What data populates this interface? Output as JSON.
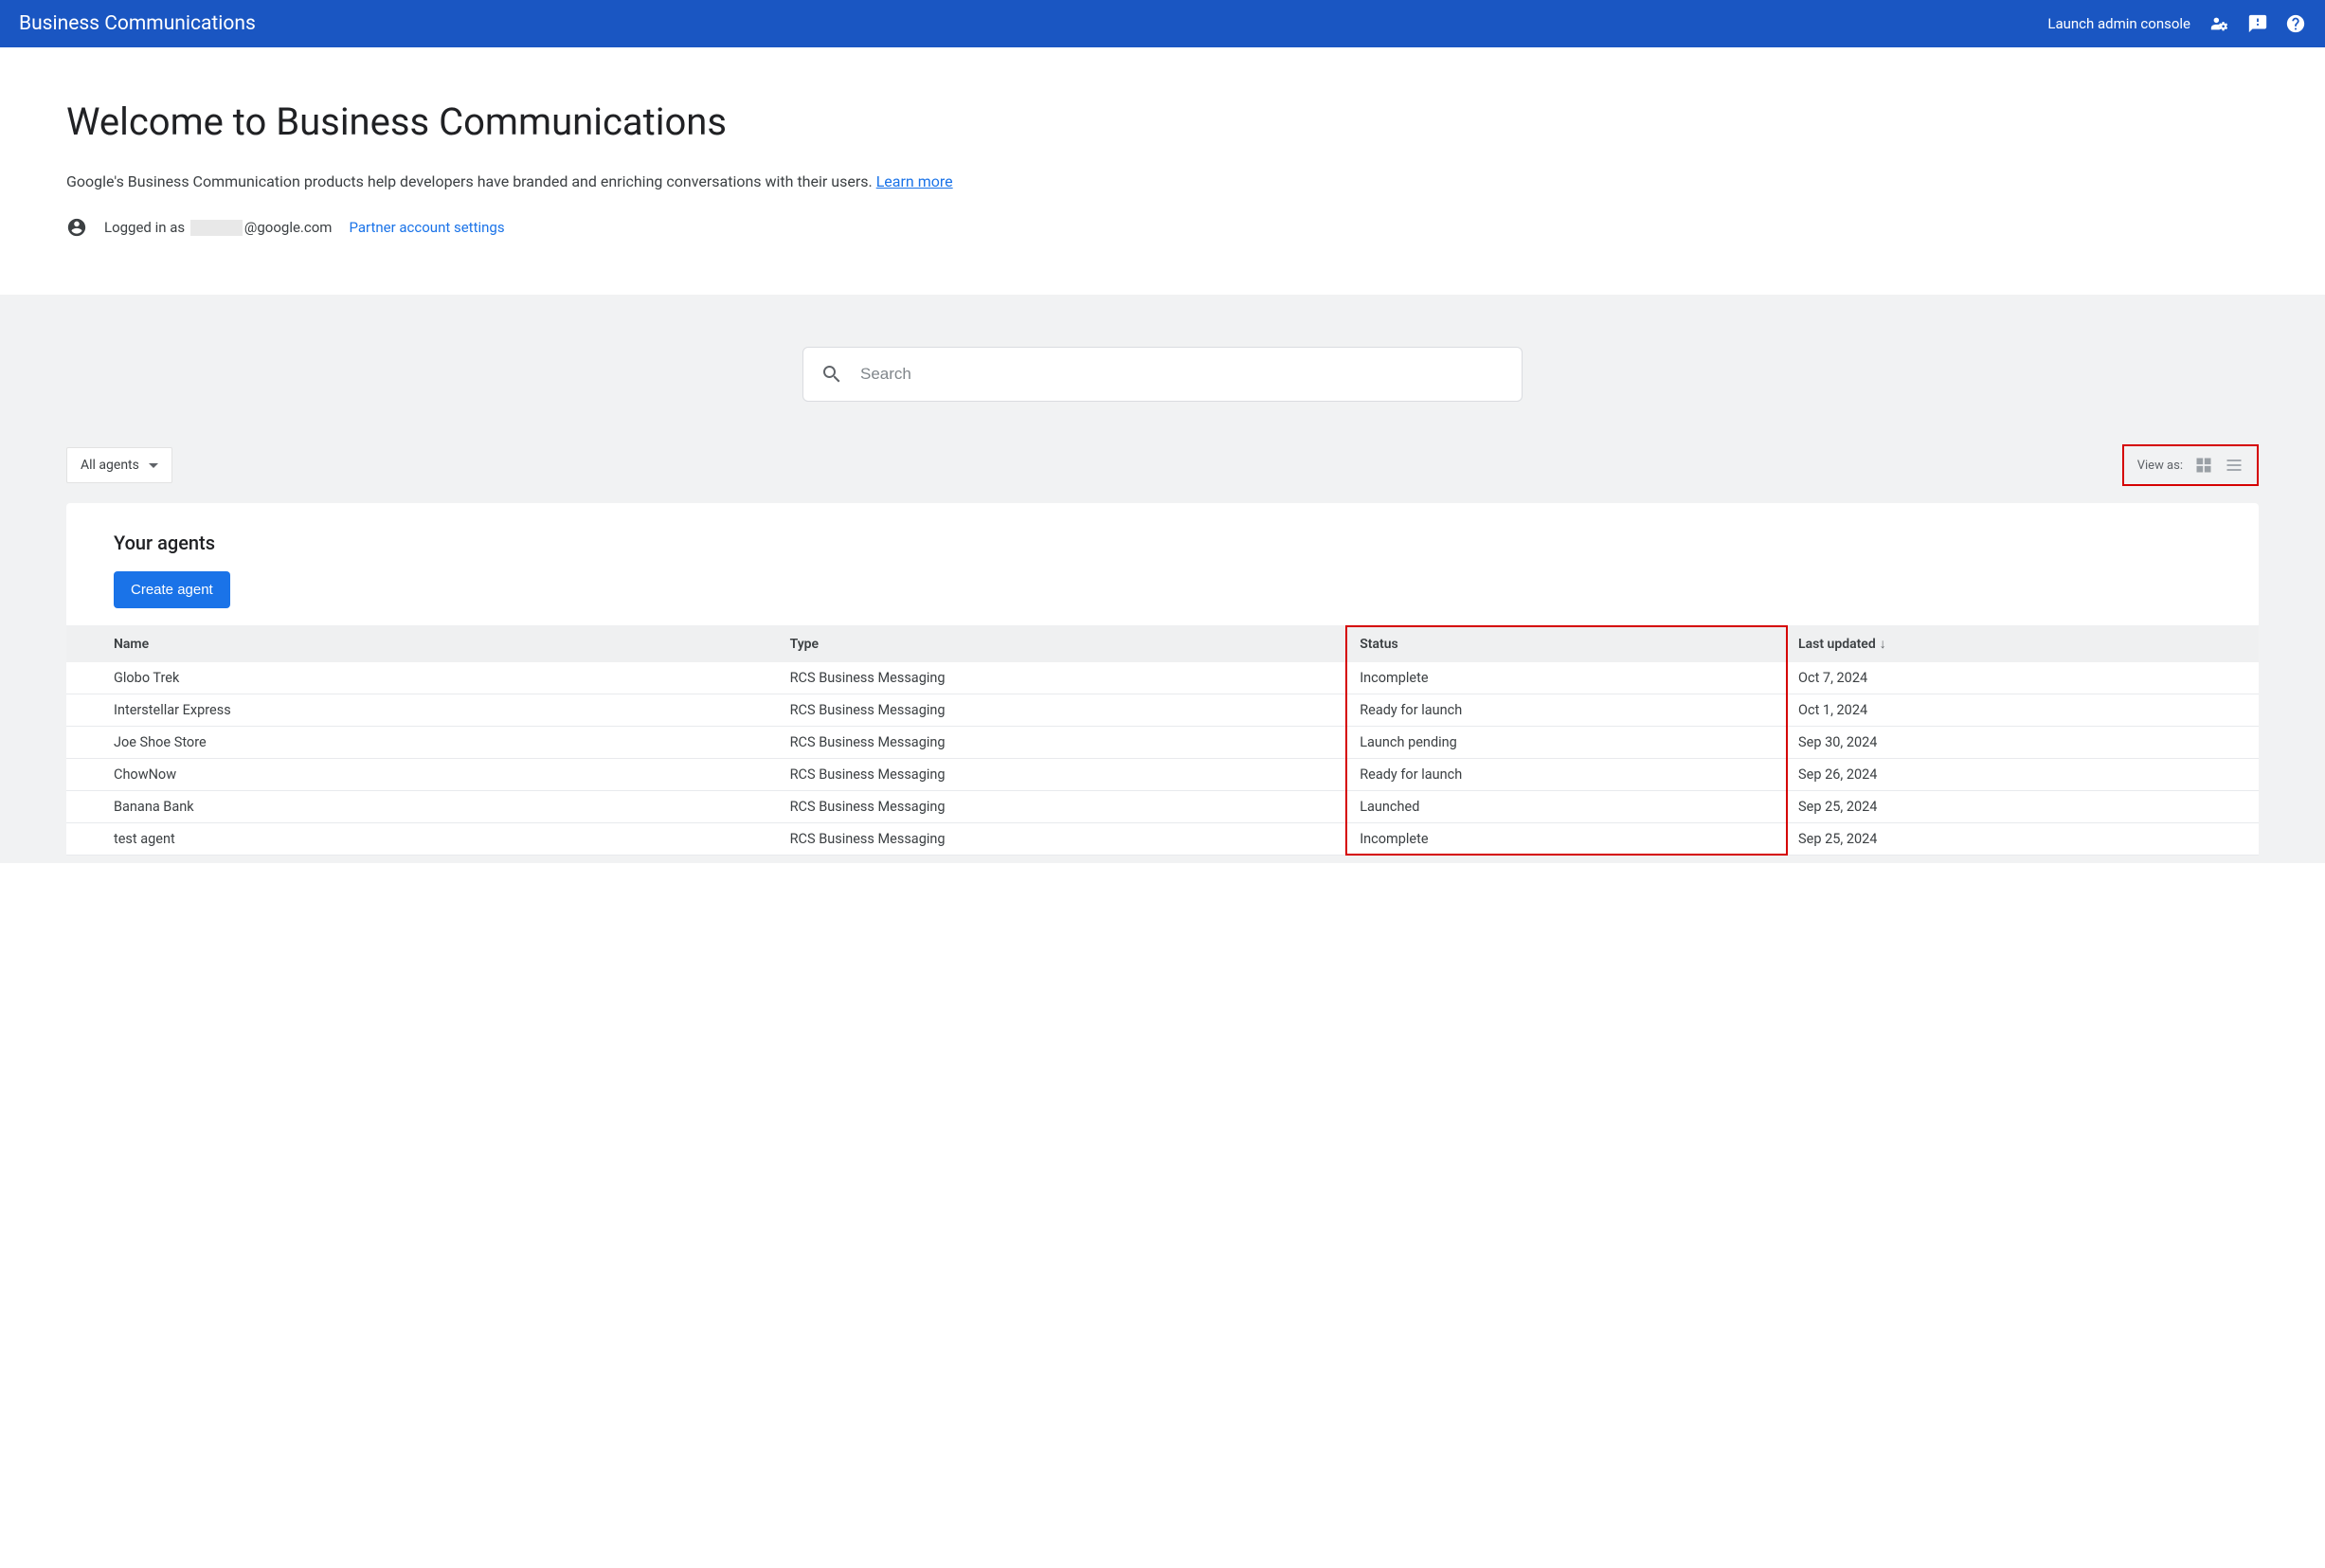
{
  "header": {
    "title": "Business Communications",
    "admin_link": "Launch admin console"
  },
  "intro": {
    "welcome": "Welcome to Business Communications",
    "desc": "Google's Business Communication products help developers have branded and enriching conversations with their users. ",
    "learn_more": "Learn more",
    "logged_prefix": "Logged in as",
    "logged_suffix": "@google.com",
    "partner_settings": "Partner account settings"
  },
  "search": {
    "placeholder": "Search"
  },
  "toolbar": {
    "filter_label": "All agents",
    "view_label": "View as:"
  },
  "agents": {
    "title": "Your agents",
    "create_label": "Create agent",
    "columns": {
      "name": "Name",
      "type": "Type",
      "status": "Status",
      "updated": "Last updated"
    },
    "rows": [
      {
        "name": "Globo Trek",
        "type": "RCS Business Messaging",
        "status": "Incomplete",
        "updated": "Oct 7, 2024"
      },
      {
        "name": "Interstellar Express",
        "type": "RCS Business Messaging",
        "status": "Ready for launch",
        "updated": "Oct 1, 2024"
      },
      {
        "name": "Joe Shoe Store",
        "type": "RCS Business Messaging",
        "status": "Launch pending",
        "updated": "Sep 30, 2024"
      },
      {
        "name": "ChowNow",
        "type": "RCS Business Messaging",
        "status": "Ready for launch",
        "updated": "Sep 26, 2024"
      },
      {
        "name": "Banana Bank",
        "type": "RCS Business Messaging",
        "status": "Launched",
        "updated": "Sep 25, 2024"
      },
      {
        "name": "test agent",
        "type": "RCS Business Messaging",
        "status": "Incomplete",
        "updated": "Sep 25, 2024"
      }
    ]
  }
}
